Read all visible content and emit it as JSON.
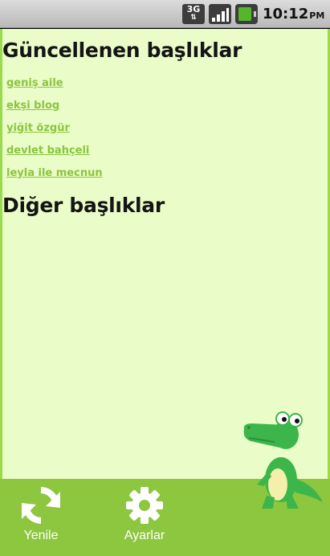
{
  "status_bar": {
    "network_label": "3G",
    "time": "10:12",
    "ampm": "PM",
    "icons": [
      "3g-network-icon",
      "signal-icon",
      "battery-icon"
    ]
  },
  "main": {
    "updated_title": "Güncellenen başlıklar",
    "updated_topics": [
      "geniş aile",
      "ekşi blog",
      "yiğit özgür",
      "devlet bahçeli",
      "leyla ile mecnun"
    ],
    "other_title": "Diğer başlıklar"
  },
  "bottom_bar": {
    "refresh_label": "Yenile",
    "settings_label": "Ayarlar"
  },
  "colors": {
    "background": "#eafcc8",
    "accent": "#8dc63f",
    "link": "#8bc53f",
    "heading": "#141414"
  }
}
